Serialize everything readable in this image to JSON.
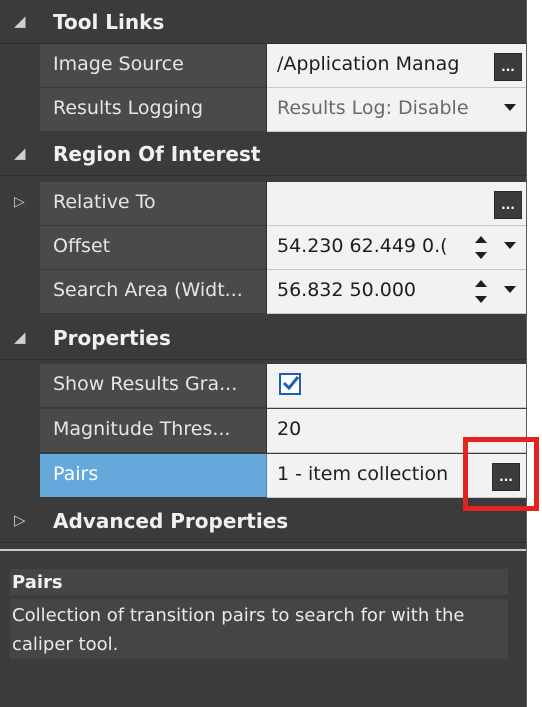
{
  "categories": {
    "tool_links": "Tool Links",
    "region_of_interest": "Region Of Interest",
    "properties": "Properties",
    "advanced_properties": "Advanced Properties"
  },
  "rows": {
    "image_source": {
      "name": "Image Source",
      "value": "/Application Manag"
    },
    "results_logging": {
      "name": "Results Logging",
      "value": "Results Log: Disable"
    },
    "relative_to": {
      "name": "Relative To",
      "value": ""
    },
    "offset": {
      "name": "Offset",
      "value": "54.230 62.449 0.("
    },
    "search_area": {
      "name": "Search Area (Widt...",
      "value": "56.832 50.000"
    },
    "show_results": {
      "name": "Show Results Gra...",
      "checked": true
    },
    "magnitude_threshold": {
      "name": "Magnitude Thres...",
      "value": "20"
    },
    "pairs": {
      "name": "Pairs",
      "value": "1 - item collection"
    }
  },
  "buttons": {
    "ellipsis": "..."
  },
  "description": {
    "title": "Pairs",
    "text": "Collection of transition pairs to search for with the caliper tool."
  },
  "colors": {
    "selection": "#64a8dc",
    "highlight_box": "#e3231f",
    "panel_bg": "#3c3c3c"
  },
  "icons": {
    "expanded": "collapse-triangle-icon",
    "collapsed": "expand-triangle-icon",
    "check": "checkmark-icon"
  }
}
